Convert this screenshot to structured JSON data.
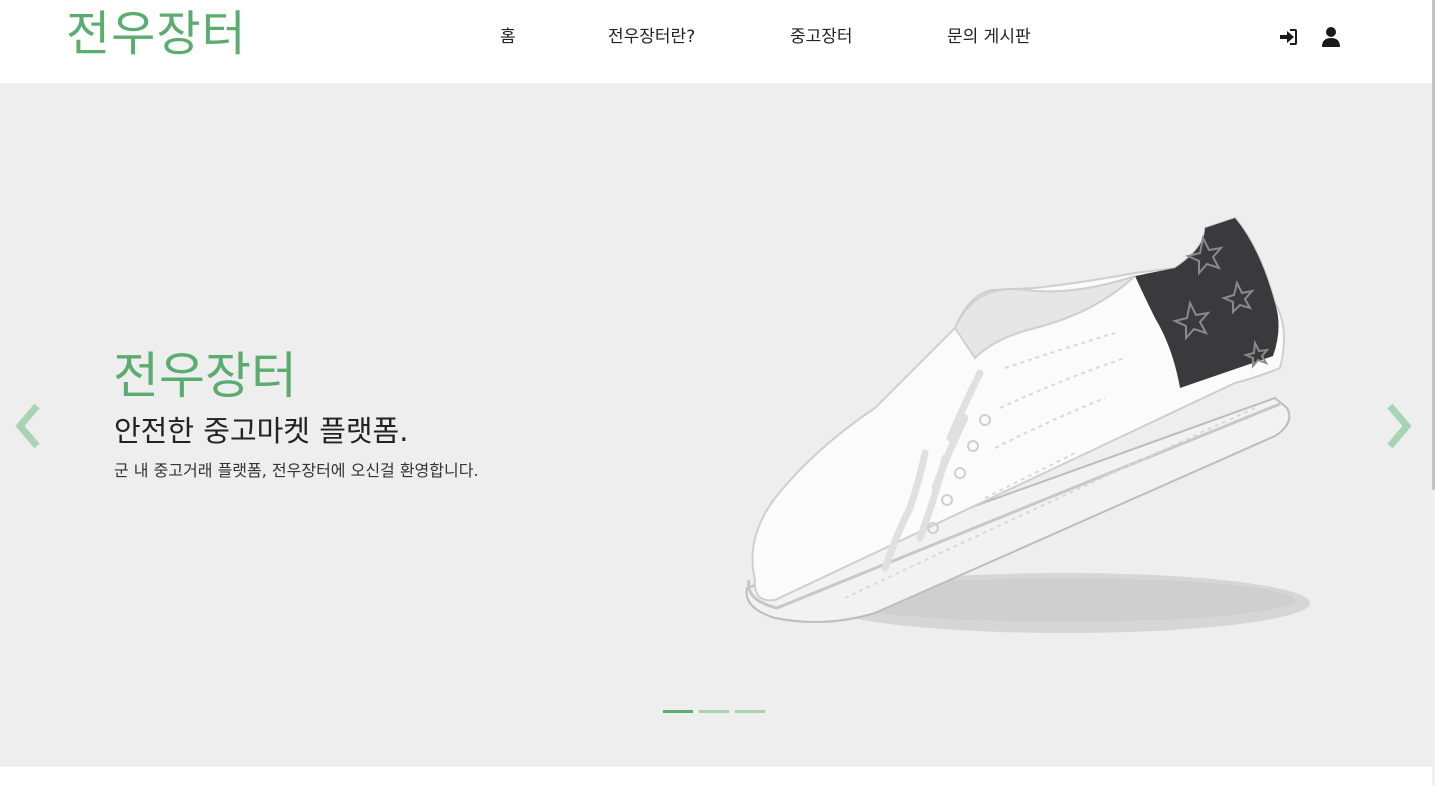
{
  "header": {
    "logo": "전우장터",
    "nav": [
      "홈",
      "전우장터란?",
      "중고장터",
      "문의 게시판"
    ],
    "icons": [
      "sign-in-icon",
      "user-icon"
    ]
  },
  "hero": {
    "title": "전우장터",
    "subtitle": "안전한 중고마켓 플랫폼.",
    "description": "군 내 중고거래 플랫폼, 전우장터에 오신걸 환영합니다.",
    "slide_count": 3,
    "active_slide": 1,
    "image": "white-sneaker-image"
  },
  "colors": {
    "brand": "#5bac6f",
    "brand_light": "#a8d4b3",
    "hero_bg": "#eeeeee",
    "text": "#222222"
  }
}
